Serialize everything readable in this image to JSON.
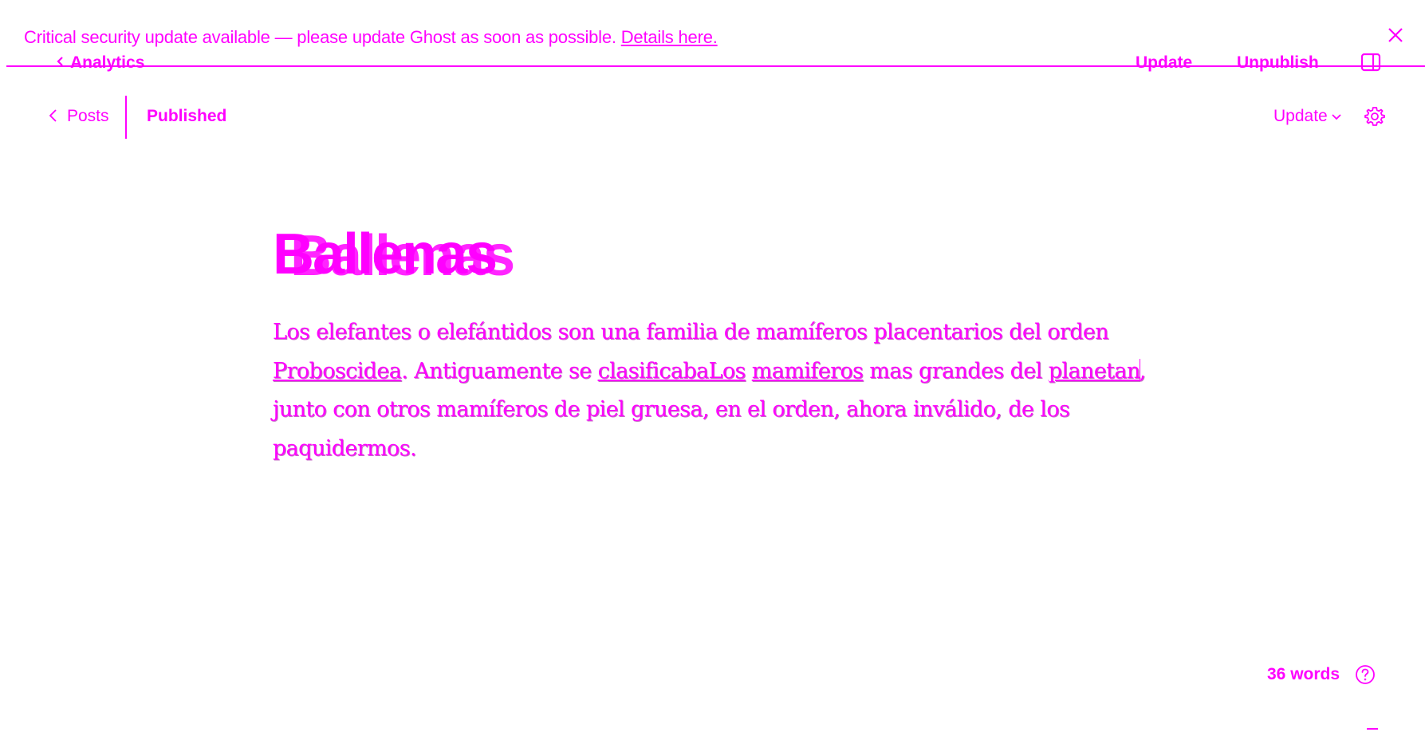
{
  "banner": {
    "message": "Critical security update available — please update Ghost as soon as possible.",
    "link_label": "Details here."
  },
  "ghost_toolbar": {
    "back_label": "Analytics",
    "update_label": "Update",
    "unpublish_label": "Unpublish"
  },
  "header": {
    "back_label": "Posts",
    "status": "Published",
    "update_label": "Update"
  },
  "post": {
    "title": "Ballenas",
    "ghost_title": "Ballenas",
    "body": {
      "seg1": "Los elefantes o elefántidos son una familia de mamíferos placentarios del orden ",
      "seg2": "Proboscidea",
      "seg3": ". Antiguamente se ",
      "seg4": "clasificabaLos",
      "seg5": " ",
      "seg6": "mamiferos",
      "seg7": " mas grandes del ",
      "seg8": "planetan",
      "seg9": ", junto con otros mamíferos de piel gruesa, en el orden, ahora inválido, de los paquidermos."
    }
  },
  "footer": {
    "word_count": "36 words"
  },
  "icons": {
    "close": "close-icon",
    "panel": "sidebar-panel-icon",
    "back": "chevron-left-icon",
    "dropdown": "chevron-down-icon",
    "settings": "gear-icon",
    "help": "help-circle-icon"
  },
  "colors": {
    "text": "#ff00ff",
    "background": "#ffffff"
  }
}
